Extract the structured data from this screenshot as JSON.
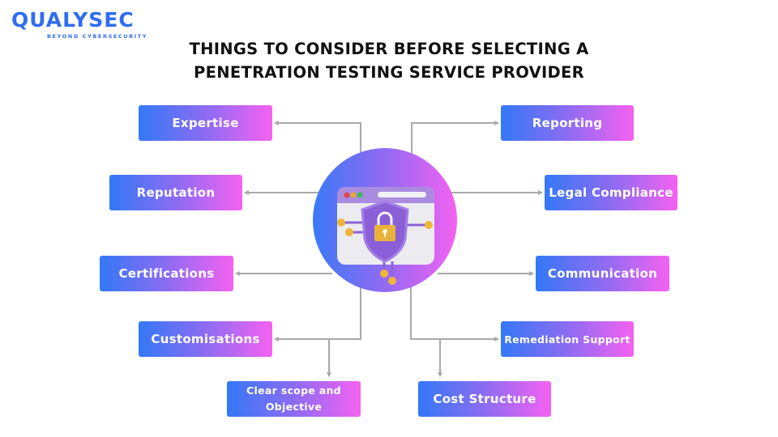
{
  "logo": {
    "name": "QUALYSEC",
    "tagline": "BEYOND CYBERSECURITY",
    "color": "#2f6df0"
  },
  "title": {
    "line1": "THINGS TO CONSIDER BEFORE SELECTING A",
    "line2": "PENETRATION TESTING SERVICE PROVIDER"
  },
  "hub": {
    "icon": "browser-shield-lock-icon"
  },
  "left_items": [
    {
      "label": "Expertise"
    },
    {
      "label": "Reputation"
    },
    {
      "label": "Certifications"
    },
    {
      "label": "Customisations"
    },
    {
      "label": "Clear scope and Objective"
    }
  ],
  "right_items": [
    {
      "label": "Reporting"
    },
    {
      "label": "Legal Compliance"
    },
    {
      "label": "Communication"
    },
    {
      "label": "Remediation Support"
    },
    {
      "label": "Cost Structure"
    }
  ],
  "colors": {
    "gradient_start": "#3478f6",
    "gradient_end": "#f462f1",
    "connector": "#a9a9a9",
    "title": "#111111"
  }
}
